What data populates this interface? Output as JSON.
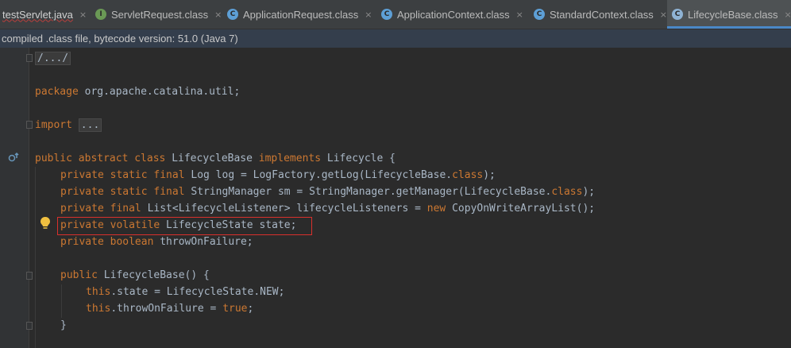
{
  "tabs": [
    {
      "label": "testServlet.java",
      "active": false,
      "icon": "none",
      "error": true
    },
    {
      "label": "ServletRequest.class",
      "active": false,
      "icon": "interface-icon"
    },
    {
      "label": "ApplicationRequest.class",
      "active": false,
      "icon": "class-icon"
    },
    {
      "label": "ApplicationContext.class",
      "active": false,
      "icon": "class-icon"
    },
    {
      "label": "StandardContext.class",
      "active": false,
      "icon": "class-icon"
    },
    {
      "label": "LifecycleBase.class",
      "active": true,
      "icon": "abstract-class-icon"
    }
  ],
  "tab_close_glyph": "×",
  "banner": "compiled .class file, bytecode version: 51.0 (Java 7)",
  "code": {
    "l1": "/.../",
    "l2_kw": "package",
    "l2_rest": " org.apache.catalina.util;",
    "l3_kw": "import",
    "l3_fold": "...",
    "l4_kw": "public abstract class",
    "l4_name": " LifecycleBase ",
    "l4_kw2": "implements",
    "l4_rest": " Lifecycle {",
    "l5_kw": "private static final",
    "l5_a": " Log log = LogFactory.getLog(LifecycleBase.",
    "l5_kw2": "class",
    "l5_b": ");",
    "l6_kw": "private static final",
    "l6_a": " StringManager sm = StringManager.getManager(LifecycleBase.",
    "l6_kw2": "class",
    "l6_b": ");",
    "l7_kw": "private final",
    "l7_a": " List<LifecycleListener> lifecycleListeners = ",
    "l7_kw2": "new",
    "l7_b": " CopyOnWriteArrayList();",
    "l8_kw": "private volatile",
    "l8_rest": " LifecycleState state;",
    "l9_kw": "private boolean",
    "l9_rest": " throwOnFailure;",
    "l10_kw": "public",
    "l10_rest": " LifecycleBase() {",
    "l11_kw": "this",
    "l11_rest": ".state = LifecycleState.NEW;",
    "l12_kw": "this",
    "l12_a": ".throwOnFailure = ",
    "l12_kw2": "true",
    "l12_b": ";",
    "l13": "}"
  },
  "colors": {
    "keyword": "#cc7832",
    "text": "#a9b7c6",
    "highlight_border": "#d9302c",
    "active_tab_underline": "#4a88c7"
  }
}
